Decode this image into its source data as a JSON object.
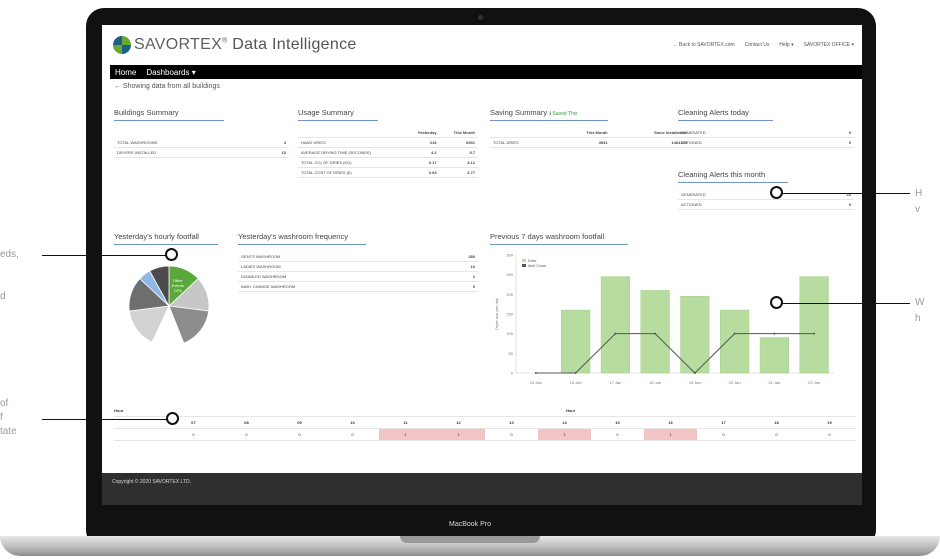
{
  "laptop": {
    "model_label": "MacBook Pro"
  },
  "callouts": {
    "left": [
      "eds,",
      "d",
      "of",
      "f",
      "tate"
    ],
    "right": [
      "H",
      "v",
      "W",
      "h"
    ]
  },
  "header": {
    "brand_name": "SAVORTEX",
    "brand_reg": "®",
    "product_name": "Data Intelligence",
    "top_links": [
      "← Back to SAVORTEX.com",
      "Contact Us",
      "Help ▾",
      "SAVORTEX OFFICE ▾"
    ]
  },
  "navbar": {
    "home": "Home",
    "dashboards": "Dashboards ▾"
  },
  "breadcrumb": "← Showing data from all buildings",
  "buildings_summary": {
    "title": "Buildings Summary",
    "rows": [
      {
        "label": "TOTAL WASHROOMS",
        "value": "4"
      },
      {
        "label": "DRYERS INSTALLED",
        "value": "10"
      }
    ]
  },
  "usage_summary": {
    "title": "Usage Summary",
    "cols": [
      "Yesterday",
      "This Month"
    ],
    "rows": [
      {
        "label": "HAND DRIES",
        "y": "216",
        "m": "6931"
      },
      {
        "label": "AVERAGE DRYING TIME (SECONDS)",
        "y": "4.2",
        "m": "5.7"
      },
      {
        "label": "TOTAL CO₂ OF DRIES (KG)",
        "y": "0.17",
        "m": "3.12"
      },
      {
        "label": "TOTAL COST OF DRIES (£)",
        "y": "0.03",
        "m": "3.77"
      }
    ]
  },
  "saving_summary": {
    "title": "Saving Summary",
    "badge": "ℹ Saved This",
    "cols": [
      "This Month",
      "Since Installation"
    ],
    "rows": [
      {
        "label": "TOTAL DRIES",
        "m": "4931",
        "i": "1464109"
      }
    ]
  },
  "alerts_today": {
    "title": "Cleaning Alerts today",
    "rows": [
      {
        "label": "GENERATED",
        "value": "0"
      },
      {
        "label": "ACTIONED",
        "value": "0"
      }
    ]
  },
  "alerts_month": {
    "title": "Cleaning Alerts this month",
    "rows": [
      {
        "label": "GENERATED",
        "value": "22"
      },
      {
        "label": "ACTIONED",
        "value": "0"
      }
    ]
  },
  "footfall_pie": {
    "title": "Yesterday's hourly footfall",
    "slices": [
      {
        "label": "Other\nEvents\n13%",
        "value": 13,
        "color": "#5aa83a"
      },
      {
        "label": "",
        "value": 14,
        "color": "#c7c7c7"
      },
      {
        "label": "",
        "value": 17,
        "color": "#8d8d8d"
      },
      {
        "label": "",
        "value": 13,
        "color": "#ffffff"
      },
      {
        "label": "",
        "value": 16,
        "color": "#d2d2d2"
      },
      {
        "label": "",
        "value": 14,
        "color": "#6e6e6e"
      },
      {
        "label": "",
        "value": 5,
        "color": "#8db7e5"
      },
      {
        "label": "",
        "value": 8,
        "color": "#4b4b4b"
      }
    ]
  },
  "washroom_frequency": {
    "title": "Yesterday's washroom frequency",
    "rows": [
      {
        "label": "GENTS WASHROOM",
        "value": "280"
      },
      {
        "label": "LADIES WASHROOM",
        "value": "16"
      },
      {
        "label": "DISABLED WASHROOM",
        "value": "2"
      },
      {
        "label": "BABY CHANGE WASHROOM",
        "value": "0"
      }
    ]
  },
  "chart_data": {
    "type": "bar",
    "title": "Previous 7 days washroom footfall",
    "ylabel": "Dryer use per day",
    "categories": [
      "15 Jan",
      "16 Jan",
      "17 Jan",
      "18 Jan",
      "19 Jan",
      "20 Jan",
      "21 Jan",
      "22 Jan"
    ],
    "series": [
      {
        "name": "Dries",
        "type": "bar",
        "values": [
          0,
          160,
          245,
          210,
          195,
          160,
          90,
          245
        ],
        "color": "#b7dca0"
      },
      {
        "name": "Alert Count",
        "type": "line",
        "values": [
          0,
          0,
          1,
          1,
          0,
          1,
          1,
          1
        ],
        "color": "#555555"
      }
    ],
    "ylim": [
      0,
      300
    ],
    "yticks": [
      0,
      50,
      100,
      150,
      200,
      250,
      300
    ],
    "y2lim": [
      0,
      3
    ]
  },
  "hours": {
    "label": "Hour",
    "headers": [
      "07",
      "08",
      "09",
      "10",
      "11",
      "12",
      "13",
      "14",
      "15",
      "16",
      "17",
      "18",
      "19"
    ],
    "values": [
      "0",
      "0",
      "0",
      "0",
      "1",
      "1",
      "0",
      "1",
      "0",
      "1",
      "0",
      "0",
      "0"
    ]
  },
  "footer": "Copyright © 2020 SAVORTEX LTD."
}
